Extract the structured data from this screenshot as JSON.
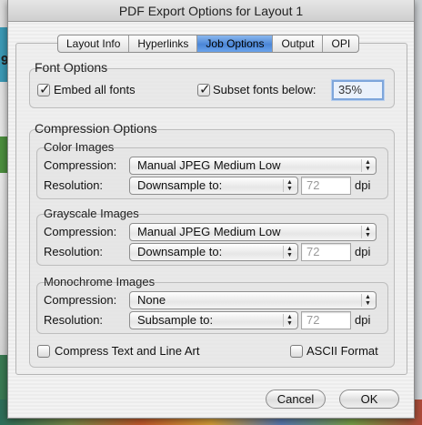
{
  "window": {
    "title": "PDF Export Options for Layout 1"
  },
  "tabs": [
    {
      "label": "Layout Info",
      "active": false
    },
    {
      "label": "Hyperlinks",
      "active": false
    },
    {
      "label": "Job Options",
      "active": true
    },
    {
      "label": "Output",
      "active": false
    },
    {
      "label": "OPI",
      "active": false
    }
  ],
  "font_options": {
    "title": "Font Options",
    "embed_all_fonts": {
      "label": "Embed all fonts",
      "checked": true
    },
    "subset_fonts": {
      "label": "Subset fonts below:",
      "checked": true,
      "value": "35%"
    }
  },
  "compression_options": {
    "title": "Compression Options",
    "compression_label": "Compression:",
    "resolution_label": "Resolution:",
    "dpi_label": "dpi",
    "color": {
      "title": "Color Images",
      "compression": "Manual JPEG Medium Low",
      "resolution_mode": "Downsample to:",
      "resolution_value": "72"
    },
    "grayscale": {
      "title": "Grayscale Images",
      "compression": "Manual JPEG Medium Low",
      "resolution_mode": "Downsample to:",
      "resolution_value": "72"
    },
    "monochrome": {
      "title": "Monochrome Images",
      "compression": "None",
      "resolution_mode": "Subsample to:",
      "resolution_value": "72"
    }
  },
  "options": {
    "compress_text": {
      "label": "Compress Text and Line Art",
      "checked": false
    },
    "ascii_format": {
      "label": "ASCII Format",
      "checked": false
    }
  },
  "buttons": {
    "cancel": "Cancel",
    "ok": "OK"
  },
  "background": {
    "fragment_text": "9"
  },
  "colors": {
    "tab_active": "#4b86d6",
    "focus_ring": "#7ea6db"
  }
}
